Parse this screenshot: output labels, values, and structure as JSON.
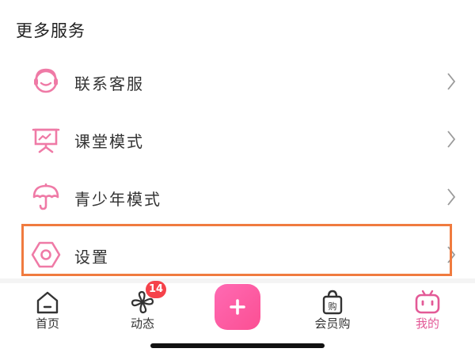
{
  "section": {
    "title": "更多服务"
  },
  "menu": {
    "items": [
      {
        "label": "联系客服",
        "icon": "headset-icon"
      },
      {
        "label": "课堂模式",
        "icon": "presentation-board-icon"
      },
      {
        "label": "青少年模式",
        "icon": "umbrella-icon"
      },
      {
        "label": "设置",
        "icon": "hexagon-settings-icon"
      }
    ]
  },
  "tabbar": {
    "items": [
      {
        "label": "首页",
        "icon": "home-icon"
      },
      {
        "label": "动态",
        "icon": "pinwheel-icon",
        "badge": "14"
      },
      {
        "label": "",
        "icon": "plus-icon"
      },
      {
        "label": "会员购",
        "icon": "shopping-bag-icon"
      },
      {
        "label": "我的",
        "icon": "tv-face-icon",
        "active": true
      }
    ]
  },
  "colors": {
    "accent": "#e35a97",
    "icon_pink": "#ef7aa6",
    "highlight": "#f07b3f",
    "badge": "#f5424a"
  }
}
